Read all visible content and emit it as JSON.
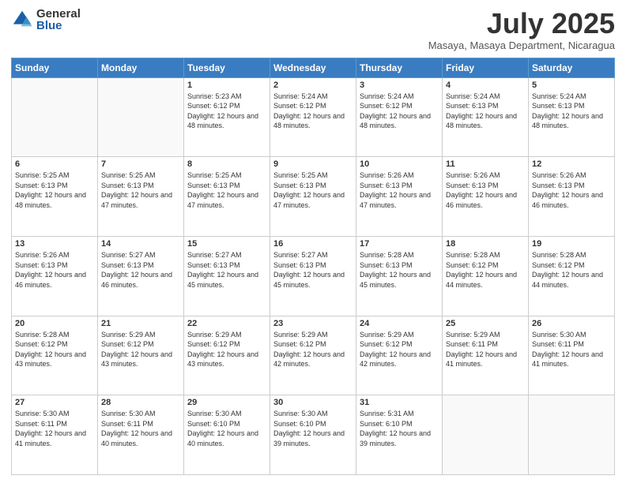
{
  "header": {
    "logo_general": "General",
    "logo_blue": "Blue",
    "month_title": "July 2025",
    "location": "Masaya, Masaya Department, Nicaragua"
  },
  "weekdays": [
    "Sunday",
    "Monday",
    "Tuesday",
    "Wednesday",
    "Thursday",
    "Friday",
    "Saturday"
  ],
  "weeks": [
    [
      {
        "day": "",
        "info": ""
      },
      {
        "day": "",
        "info": ""
      },
      {
        "day": "1",
        "info": "Sunrise: 5:23 AM\nSunset: 6:12 PM\nDaylight: 12 hours and 48 minutes."
      },
      {
        "day": "2",
        "info": "Sunrise: 5:24 AM\nSunset: 6:12 PM\nDaylight: 12 hours and 48 minutes."
      },
      {
        "day": "3",
        "info": "Sunrise: 5:24 AM\nSunset: 6:12 PM\nDaylight: 12 hours and 48 minutes."
      },
      {
        "day": "4",
        "info": "Sunrise: 5:24 AM\nSunset: 6:13 PM\nDaylight: 12 hours and 48 minutes."
      },
      {
        "day": "5",
        "info": "Sunrise: 5:24 AM\nSunset: 6:13 PM\nDaylight: 12 hours and 48 minutes."
      }
    ],
    [
      {
        "day": "6",
        "info": "Sunrise: 5:25 AM\nSunset: 6:13 PM\nDaylight: 12 hours and 48 minutes."
      },
      {
        "day": "7",
        "info": "Sunrise: 5:25 AM\nSunset: 6:13 PM\nDaylight: 12 hours and 47 minutes."
      },
      {
        "day": "8",
        "info": "Sunrise: 5:25 AM\nSunset: 6:13 PM\nDaylight: 12 hours and 47 minutes."
      },
      {
        "day": "9",
        "info": "Sunrise: 5:25 AM\nSunset: 6:13 PM\nDaylight: 12 hours and 47 minutes."
      },
      {
        "day": "10",
        "info": "Sunrise: 5:26 AM\nSunset: 6:13 PM\nDaylight: 12 hours and 47 minutes."
      },
      {
        "day": "11",
        "info": "Sunrise: 5:26 AM\nSunset: 6:13 PM\nDaylight: 12 hours and 46 minutes."
      },
      {
        "day": "12",
        "info": "Sunrise: 5:26 AM\nSunset: 6:13 PM\nDaylight: 12 hours and 46 minutes."
      }
    ],
    [
      {
        "day": "13",
        "info": "Sunrise: 5:26 AM\nSunset: 6:13 PM\nDaylight: 12 hours and 46 minutes."
      },
      {
        "day": "14",
        "info": "Sunrise: 5:27 AM\nSunset: 6:13 PM\nDaylight: 12 hours and 46 minutes."
      },
      {
        "day": "15",
        "info": "Sunrise: 5:27 AM\nSunset: 6:13 PM\nDaylight: 12 hours and 45 minutes."
      },
      {
        "day": "16",
        "info": "Sunrise: 5:27 AM\nSunset: 6:13 PM\nDaylight: 12 hours and 45 minutes."
      },
      {
        "day": "17",
        "info": "Sunrise: 5:28 AM\nSunset: 6:13 PM\nDaylight: 12 hours and 45 minutes."
      },
      {
        "day": "18",
        "info": "Sunrise: 5:28 AM\nSunset: 6:12 PM\nDaylight: 12 hours and 44 minutes."
      },
      {
        "day": "19",
        "info": "Sunrise: 5:28 AM\nSunset: 6:12 PM\nDaylight: 12 hours and 44 minutes."
      }
    ],
    [
      {
        "day": "20",
        "info": "Sunrise: 5:28 AM\nSunset: 6:12 PM\nDaylight: 12 hours and 43 minutes."
      },
      {
        "day": "21",
        "info": "Sunrise: 5:29 AM\nSunset: 6:12 PM\nDaylight: 12 hours and 43 minutes."
      },
      {
        "day": "22",
        "info": "Sunrise: 5:29 AM\nSunset: 6:12 PM\nDaylight: 12 hours and 43 minutes."
      },
      {
        "day": "23",
        "info": "Sunrise: 5:29 AM\nSunset: 6:12 PM\nDaylight: 12 hours and 42 minutes."
      },
      {
        "day": "24",
        "info": "Sunrise: 5:29 AM\nSunset: 6:12 PM\nDaylight: 12 hours and 42 minutes."
      },
      {
        "day": "25",
        "info": "Sunrise: 5:29 AM\nSunset: 6:11 PM\nDaylight: 12 hours and 41 minutes."
      },
      {
        "day": "26",
        "info": "Sunrise: 5:30 AM\nSunset: 6:11 PM\nDaylight: 12 hours and 41 minutes."
      }
    ],
    [
      {
        "day": "27",
        "info": "Sunrise: 5:30 AM\nSunset: 6:11 PM\nDaylight: 12 hours and 41 minutes."
      },
      {
        "day": "28",
        "info": "Sunrise: 5:30 AM\nSunset: 6:11 PM\nDaylight: 12 hours and 40 minutes."
      },
      {
        "day": "29",
        "info": "Sunrise: 5:30 AM\nSunset: 6:10 PM\nDaylight: 12 hours and 40 minutes."
      },
      {
        "day": "30",
        "info": "Sunrise: 5:30 AM\nSunset: 6:10 PM\nDaylight: 12 hours and 39 minutes."
      },
      {
        "day": "31",
        "info": "Sunrise: 5:31 AM\nSunset: 6:10 PM\nDaylight: 12 hours and 39 minutes."
      },
      {
        "day": "",
        "info": ""
      },
      {
        "day": "",
        "info": ""
      }
    ]
  ]
}
